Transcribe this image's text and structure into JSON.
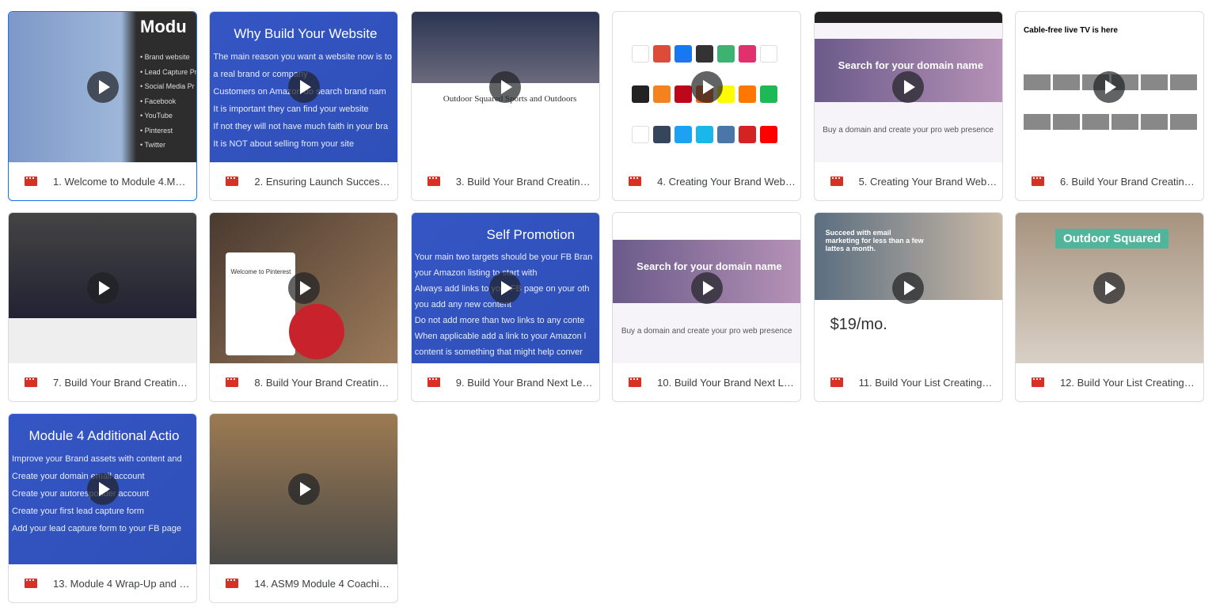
{
  "accent": "#1a73e8",
  "file_icon": "video-file-icon",
  "file_icon_color": "#d93025",
  "items": [
    {
      "name": "1. Welcome to Module 4.M…",
      "selected": true,
      "thumb": {
        "title": "Modu",
        "lines": [
          "• Brand website",
          "• Lead Capture Pr",
          "• Social Media Pr",
          "• Facebook",
          "• YouTube",
          "• Pinterest",
          "• Twitter"
        ]
      }
    },
    {
      "name": "2. Ensuring Launch Succes…",
      "thumb": {
        "title": "Why Build Your Website",
        "lines": [
          "The main reason you want a website now is to",
          "a real brand or company",
          "Customers on Amazon do search brand nam",
          "It is important they can find your website",
          "If not they will not have much faith in your bra",
          "It is NOT about selling from your site"
        ]
      }
    },
    {
      "name": "3. Build Your Brand Creatin…",
      "thumb": {
        "title": "Outdoor Squared Sports and Outdoors"
      }
    },
    {
      "name": "4. Creating Your Brand Web…",
      "thumb": {}
    },
    {
      "name": "5. Creating Your Brand Web…",
      "thumb": {
        "title": "Search for your domain name",
        "subtitle": "Buy a domain and create your pro web presence"
      }
    },
    {
      "name": "6. Build Your Brand Creatin…",
      "thumb": {
        "title": "Cable-free live TV is here"
      }
    },
    {
      "name": "7. Build Your Brand Creatin…",
      "thumb": {}
    },
    {
      "name": "8. Build Your Brand Creatin…",
      "thumb": {
        "title": "Welcome to Pinterest"
      }
    },
    {
      "name": "9. Build Your Brand Next Le…",
      "thumb": {
        "title": "Self Promotion",
        "lines": [
          "Your main two targets should be your FB Bran",
          "your Amazon listing to start with",
          "Always add links to your FB page on your oth",
          "you add any new content",
          "Do not add more than two links to any conte",
          "When applicable add a link to your Amazon l",
          "content is something that might help conver"
        ]
      }
    },
    {
      "name": "10. Build Your Brand Next L…",
      "thumb": {
        "title": "Search for your domain name",
        "subtitle": "Buy a domain and create your pro web presence"
      }
    },
    {
      "name": "11. Build Your List Creating…",
      "thumb": {
        "title": "Succeed with email marketing for less than a few lattes a month.",
        "price": "$19/mo."
      }
    },
    {
      "name": "12. Build Your List Creating…",
      "thumb": {
        "title": "Outdoor Squared"
      }
    },
    {
      "name": "13. Module 4 Wrap-Up and …",
      "thumb": {
        "title": "Module 4 Additional Actio",
        "lines": [
          "Improve your Brand assets with content and",
          "Create your domain email account",
          "Create your autoresponder account",
          "Create your first lead capture form",
          "Add your lead capture form to your FB page"
        ]
      }
    },
    {
      "name": "14. ASM9 Module 4 Coachi…",
      "thumb": {}
    }
  ]
}
